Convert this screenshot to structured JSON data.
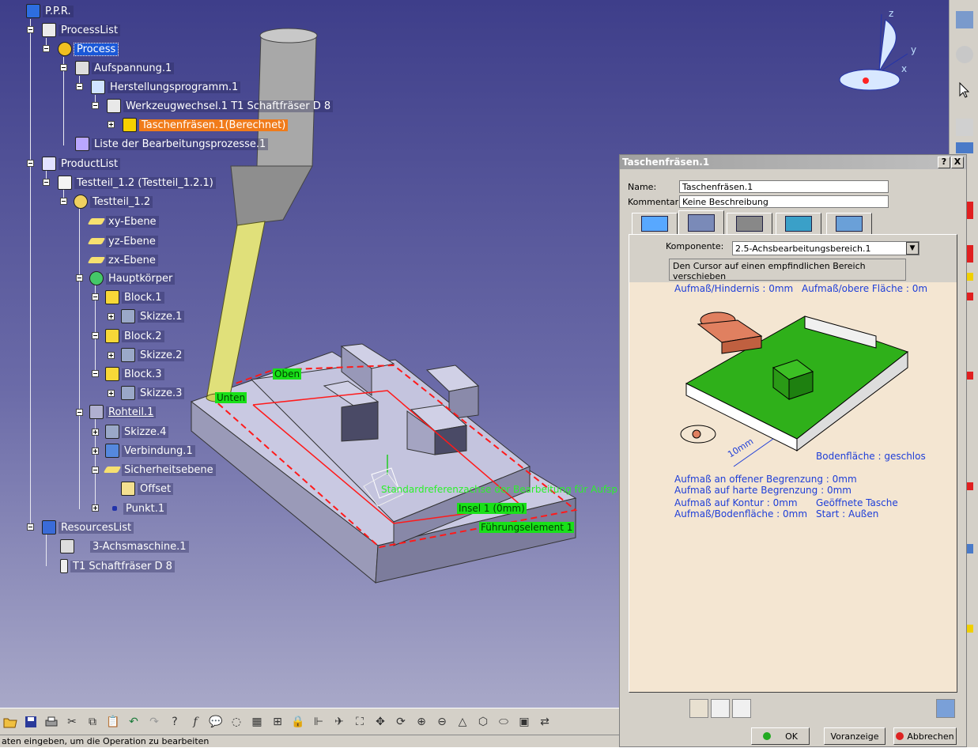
{
  "tree": {
    "items": [
      {
        "label": "P.P.R."
      },
      {
        "label": "ProcessList"
      },
      {
        "label": "Process"
      },
      {
        "label": "Aufspannung.1"
      },
      {
        "label": "Herstellungsprogramm.1"
      },
      {
        "label": "Werkzeugwechsel.1  T1 Schaftfräser D 8"
      },
      {
        "label": "Taschenfräsen.1(Berechnet)"
      },
      {
        "label": "Liste der Bearbeitungsprozesse.1"
      },
      {
        "label": "ProductList"
      },
      {
        "label": "Testteil_1.2 (Testteil_1.2.1)"
      },
      {
        "label": "Testteil_1.2"
      },
      {
        "label": "xy-Ebene"
      },
      {
        "label": "yz-Ebene"
      },
      {
        "label": "zx-Ebene"
      },
      {
        "label": "Hauptkörper"
      },
      {
        "label": "Block.1"
      },
      {
        "label": "Skizze.1"
      },
      {
        "label": "Block.2"
      },
      {
        "label": "Skizze.2"
      },
      {
        "label": "Block.3"
      },
      {
        "label": "Skizze.3"
      },
      {
        "label": "Rohteil.1"
      },
      {
        "label": "Skizze.4"
      },
      {
        "label": "Verbindung.1"
      },
      {
        "label": "Sicherheitsebene"
      },
      {
        "label": "Offset"
      },
      {
        "label": "Punkt.1"
      },
      {
        "label": "ResourcesList"
      },
      {
        "label": "3-Achsmaschine.1"
      },
      {
        "label": "T1 Schaftfräser D 8"
      }
    ]
  },
  "viewport": {
    "labels": {
      "oben": "Oben",
      "unten": "Unten",
      "referenz": "Standardreferenzachse der Bearbeitung für Aufsp",
      "insel": "Insel 1 (0mm)",
      "fuehrung": "Führungselement 1"
    },
    "compass": {
      "z": "z",
      "y": "y",
      "x": "x"
    }
  },
  "dialog": {
    "title": "Taschenfräsen.1",
    "help": "?",
    "close": "X",
    "name_label": "Name:",
    "name_value": "Taschenfräsen.1",
    "comment_label": "Kommentar:",
    "comment_value": "Keine Beschreibung",
    "component_label": "Komponente:",
    "component_value": "2.5-Achsbearbeitungsbereich.1",
    "hint": "Den Cursor auf einen empfindlichen Bereich verschieben",
    "params": {
      "hindernis": "Aufmaß/Hindernis : 0mm",
      "obere": "Aufmaß/obere Fläche : 0m",
      "boden": "Bodenfläche : geschlos",
      "dim": "10mm",
      "offen": "Aufmaß an offener Begrenzung : 0mm",
      "harte": "Aufmaß auf harte Begrenzung : 0mm",
      "kontur": "Aufmaß auf Kontur : 0mm",
      "geoeffnet": "Geöffnete Tasche",
      "bodenflaeche": "Aufmaß/Bodenfläche : 0mm",
      "start": "Start : Außen"
    },
    "ok": "OK",
    "preview": "Voranzeige",
    "cancel": "Abbrechen"
  },
  "status": "aten eingeben, um die Operation zu bearbeiten",
  "colors": {
    "selection": "#1a58d8",
    "highlight": "#f07b1a",
    "label_green": "#19e019",
    "param_blue": "#1e3ed8"
  }
}
